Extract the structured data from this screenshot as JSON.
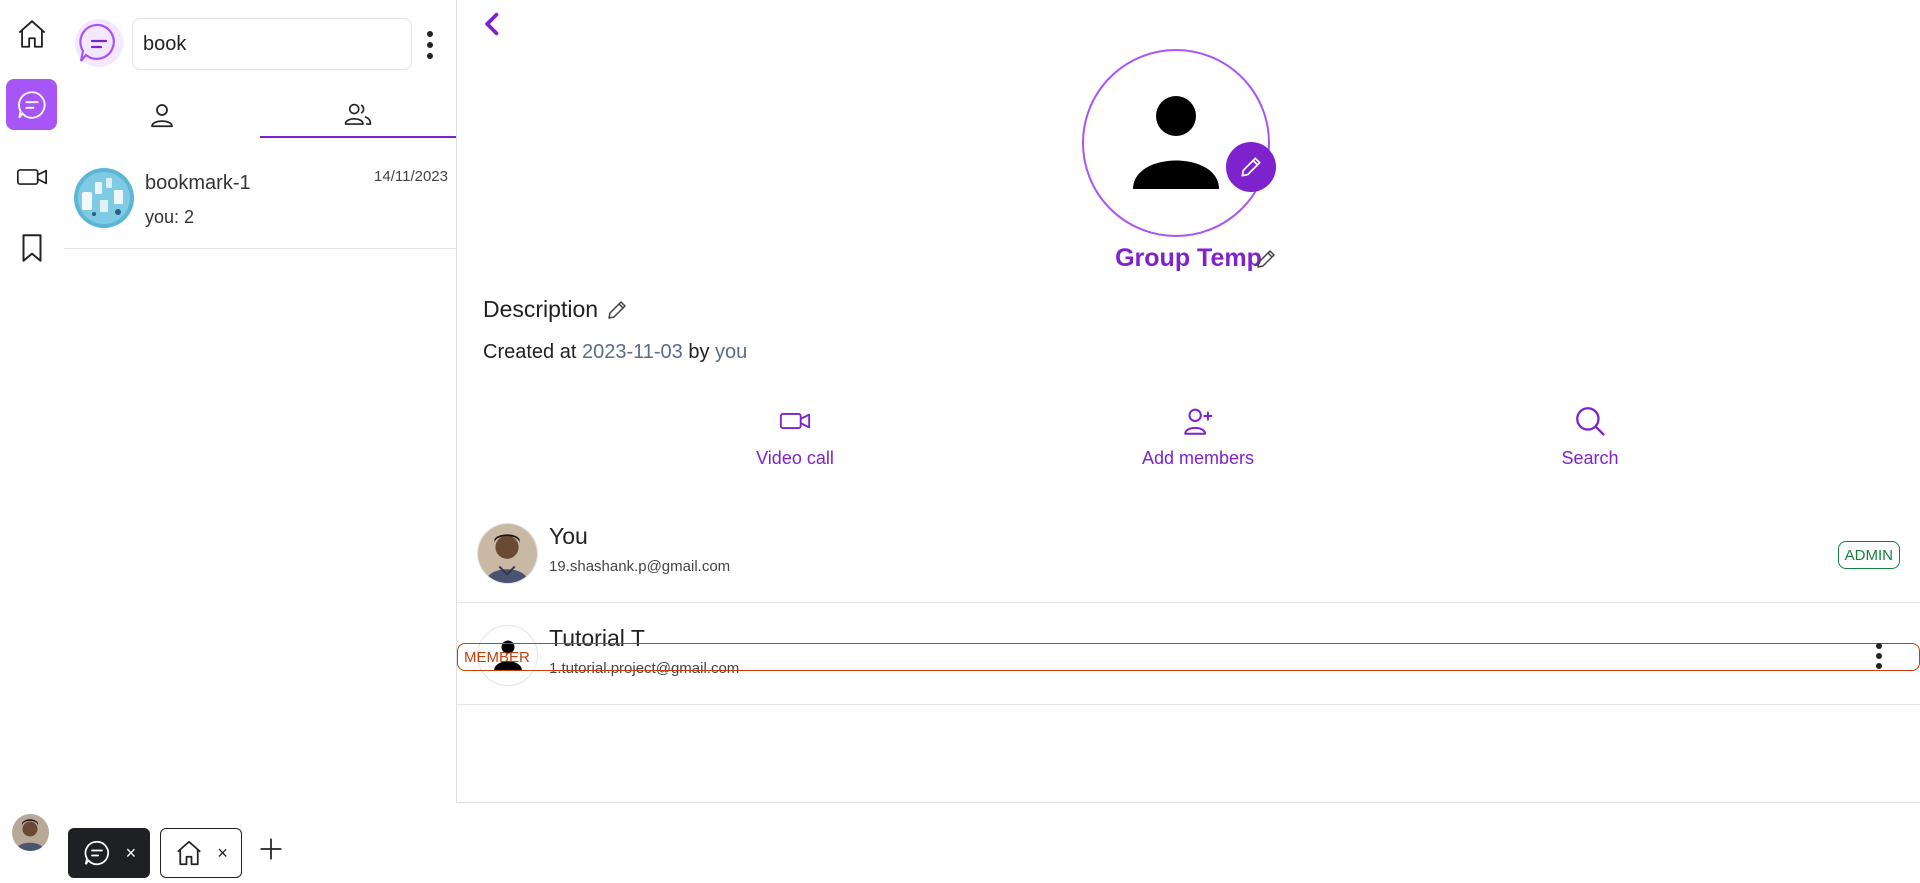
{
  "rail": {
    "items": [
      {
        "icon": "home-icon",
        "active": false
      },
      {
        "icon": "chat-icon",
        "active": true
      },
      {
        "icon": "video-icon",
        "active": false
      },
      {
        "icon": "bookmark-icon",
        "active": false
      }
    ]
  },
  "sidebar": {
    "search": {
      "value": "book"
    },
    "tabs": [
      {
        "icon": "user-icon",
        "active": false
      },
      {
        "icon": "users-icon",
        "active": true
      }
    ],
    "chats": [
      {
        "name": "bookmark-1",
        "date": "14/11/2023",
        "preview": "you: 2"
      }
    ]
  },
  "group": {
    "name": "Group Temp",
    "description_label": "Description",
    "created_prefix": "Created at",
    "created_date": "2023-11-03",
    "created_by_word": "by",
    "created_by": "you"
  },
  "actions": [
    {
      "label": "Video call",
      "icon": "video-icon"
    },
    {
      "label": "Add members",
      "icon": "add-user-icon"
    },
    {
      "label": "Search",
      "icon": "search-icon"
    }
  ],
  "members": [
    {
      "name": "You",
      "email": "19.shashank.p@gmail.com",
      "role": "ADMIN"
    },
    {
      "name": "Tutorial T",
      "email": "1.tutorial.project@gmail.com",
      "role": "MEMBER"
    }
  ],
  "bottom_tabs": [
    {
      "icon": "chat-icon",
      "close": "×",
      "active": true
    },
    {
      "icon": "home-icon",
      "close": "×",
      "active": false
    }
  ],
  "colors": {
    "accent": "#a855f7",
    "accent_dark": "#7e22ce",
    "admin": "#15803d",
    "member": "#c2410c"
  }
}
